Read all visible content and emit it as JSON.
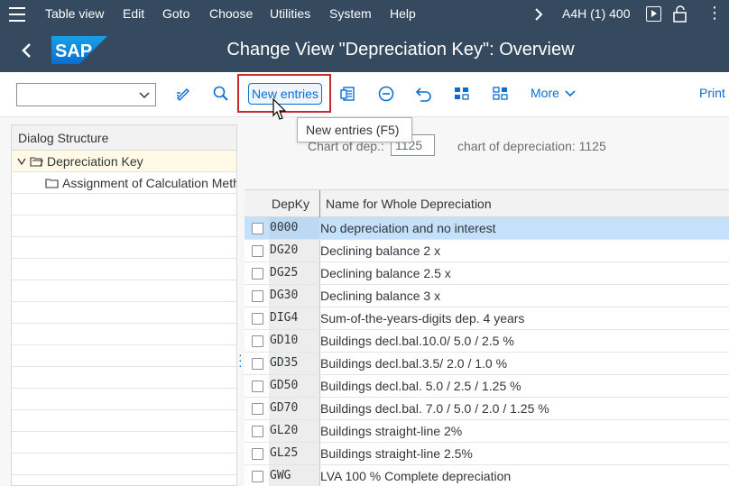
{
  "menubar": {
    "items": [
      "Table view",
      "Edit",
      "Goto",
      "Choose",
      "Utilities",
      "System",
      "Help"
    ],
    "system_info": "A4H (1) 400"
  },
  "titlebar": {
    "logo": "SAP",
    "title": "Change View \"Depreciation Key\": Overview"
  },
  "toolbar": {
    "combo_value": "",
    "new_entries_label": "New entries",
    "more_label": "More",
    "print_label": "Print"
  },
  "tooltip": {
    "text": "New entries   (F5)"
  },
  "tree": {
    "header": "Dialog Structure",
    "items": [
      {
        "label": "Depreciation Key"
      },
      {
        "label": "Assignment of Calculation Methods"
      }
    ]
  },
  "filter": {
    "label": "Chart of dep.:",
    "value": "1125",
    "description": "chart of depreciation: 1125"
  },
  "table": {
    "columns": [
      "DepKy",
      "Name for Whole Depreciation"
    ],
    "rows": [
      {
        "key": "0000",
        "name": "No depreciation and no interest"
      },
      {
        "key": "DG20",
        "name": "Declining balance 2 x"
      },
      {
        "key": "DG25",
        "name": "Declining balance 2.5 x"
      },
      {
        "key": "DG30",
        "name": "Declining balance 3 x"
      },
      {
        "key": "DIG4",
        "name": "Sum-of-the-years-digits dep. 4 years"
      },
      {
        "key": "GD10",
        "name": "Buildings decl.bal.10.0/ 5.0 / 2.5 %"
      },
      {
        "key": "GD35",
        "name": "Buildings decl.bal.3.5/ 2.0 / 1.0  %"
      },
      {
        "key": "GD50",
        "name": "Buildings decl.bal. 5.0 / 2.5 / 1.25 %"
      },
      {
        "key": "GD70",
        "name": "Buildings decl.bal. 7.0 / 5.0 / 2.0 / 1.25 %"
      },
      {
        "key": "GL20",
        "name": "Buildings straight-line 2%"
      },
      {
        "key": "GL25",
        "name": "Buildings straight-line 2.5%"
      },
      {
        "key": "GWG",
        "name": "LVA 100 % Complete depreciation"
      }
    ]
  },
  "colors": {
    "shell": "#354a5f",
    "accent": "#0a6ed1",
    "highlight_border": "#c9282d",
    "selected_row": "#c5e0fa"
  }
}
